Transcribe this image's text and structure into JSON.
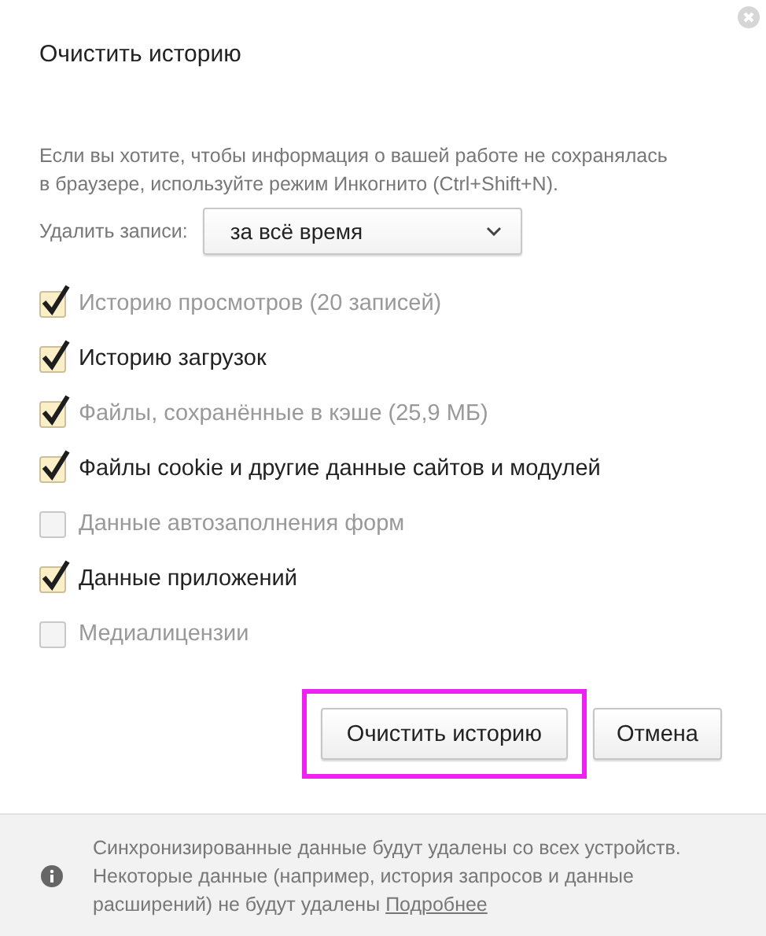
{
  "dialog": {
    "title": "Очистить историю"
  },
  "intro": {
    "lines": [
      "Если вы хотите, чтобы информация о вашей работе не сохранялась",
      "в браузере, используйте режим Инкогнито (Ctrl+Shift+N)."
    ]
  },
  "period": {
    "label": "Удалить записи:",
    "value": "за всё время"
  },
  "options": [
    {
      "label": "Историю просмотров (20 записей)",
      "checked": true,
      "dimmed": true
    },
    {
      "label": "Историю загрузок",
      "checked": true,
      "dimmed": false
    },
    {
      "label": "Файлы, сохранённые в кэше (25,9 МБ)",
      "checked": true,
      "dimmed": true
    },
    {
      "label": "Файлы cookie и другие данные сайтов и модулей",
      "checked": true,
      "dimmed": false
    },
    {
      "label": "Данные автозаполнения форм",
      "checked": false,
      "dimmed": true
    },
    {
      "label": "Данные приложений",
      "checked": true,
      "dimmed": false
    },
    {
      "label": "Медиалицензии",
      "checked": false,
      "dimmed": true
    }
  ],
  "buttons": [
    {
      "label": "Очистить историю",
      "kind": "primary",
      "highlighted": true
    },
    {
      "label": "Отмена",
      "kind": "cancel",
      "highlighted": false
    }
  ],
  "footer": {
    "lines": [
      "Синхронизированные данные будут удалены со всех устройств.",
      "Некоторые данные (например, история запросов и данные",
      "расширений) не будут удалены"
    ],
    "link": "Подробнее"
  }
}
